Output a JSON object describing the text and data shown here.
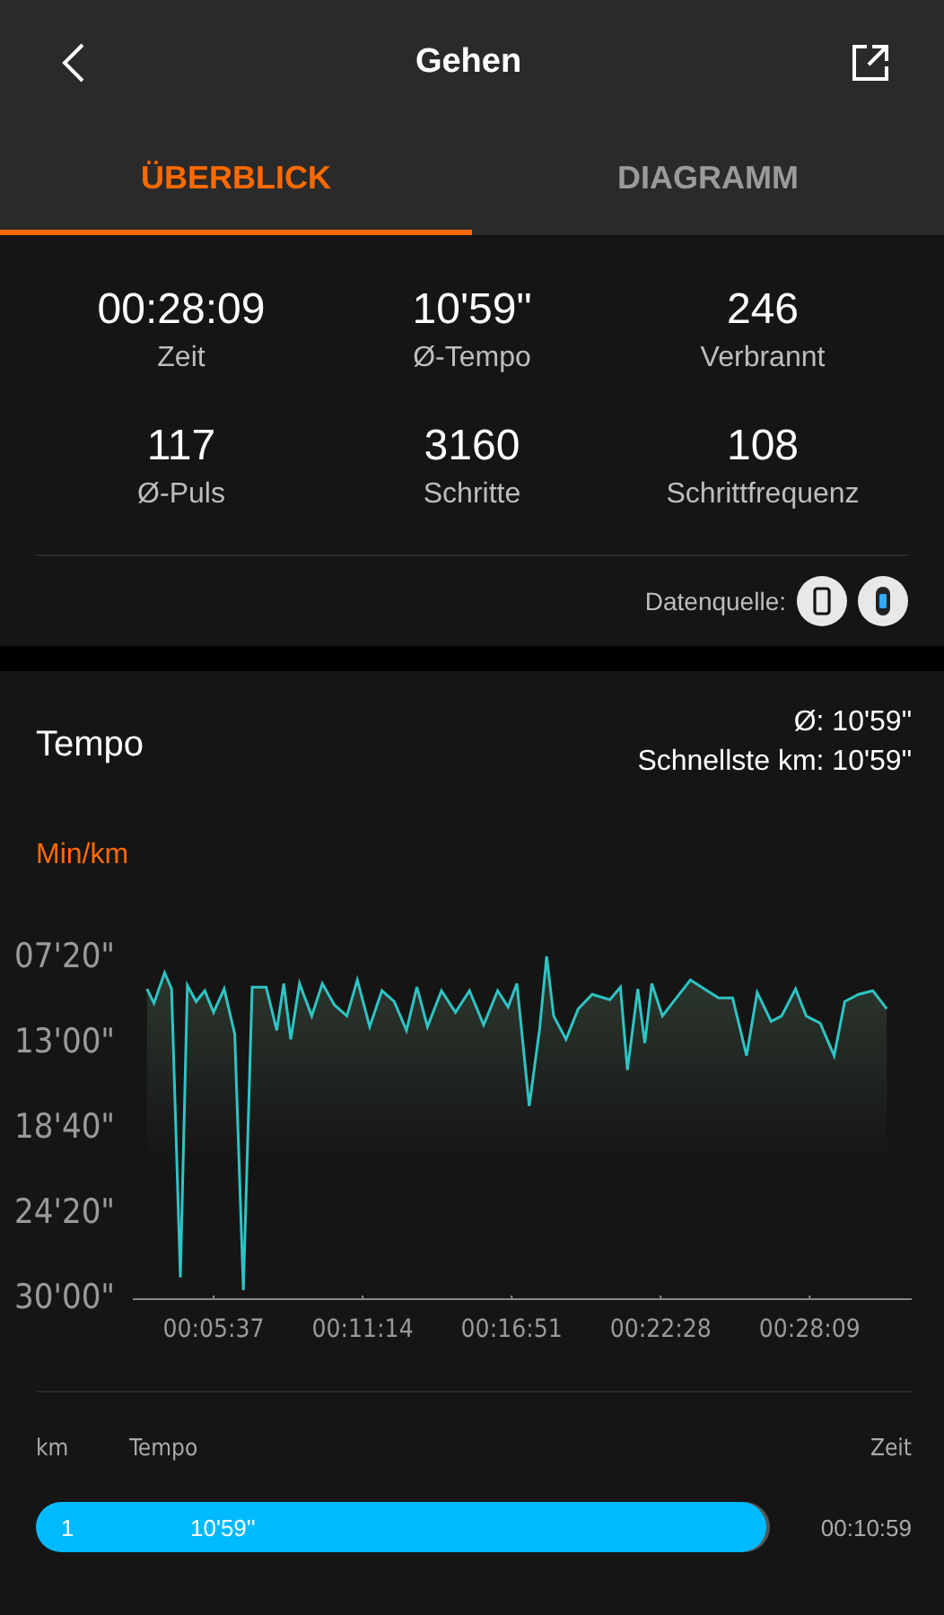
{
  "header": {
    "title": "Gehen"
  },
  "tabs": [
    {
      "label": "ÜBERBLICK",
      "selected": true
    },
    {
      "label": "DIAGRAMM",
      "selected": false
    }
  ],
  "stats": [
    {
      "value": "00:28:09",
      "label": "Zeit"
    },
    {
      "value": "10'59\"",
      "label": "Ø-Tempo"
    },
    {
      "value": "246",
      "label": "Verbrannt"
    },
    {
      "value": "117",
      "label": "Ø-Puls"
    },
    {
      "value": "3160",
      "label": "Schritte"
    },
    {
      "value": "108",
      "label": "Schrittfrequenz"
    }
  ],
  "data_source": {
    "label": "Datenquelle:",
    "sources": [
      {
        "kind": "phone"
      },
      {
        "kind": "band"
      }
    ]
  },
  "pace_card": {
    "title": "Tempo",
    "average": "Ø: 10'59\"",
    "fastest": "Schnellste km: 10'59\"",
    "unit": "Min/km",
    "chart": {
      "x_labels": [
        "00:05:37",
        "00:11:14",
        "00:16:51",
        "00:22:28",
        "00:28:09"
      ],
      "y_labels": [
        "07'20\"",
        "13'00\"",
        "18'40\"",
        "24'20\"",
        "30'00\""
      ]
    }
  },
  "laps": {
    "columns": [
      "km",
      "Tempo",
      "Zeit"
    ],
    "rows": [
      {
        "km": "1",
        "pace": "10'59''",
        "time": "00:10:59"
      }
    ]
  }
}
